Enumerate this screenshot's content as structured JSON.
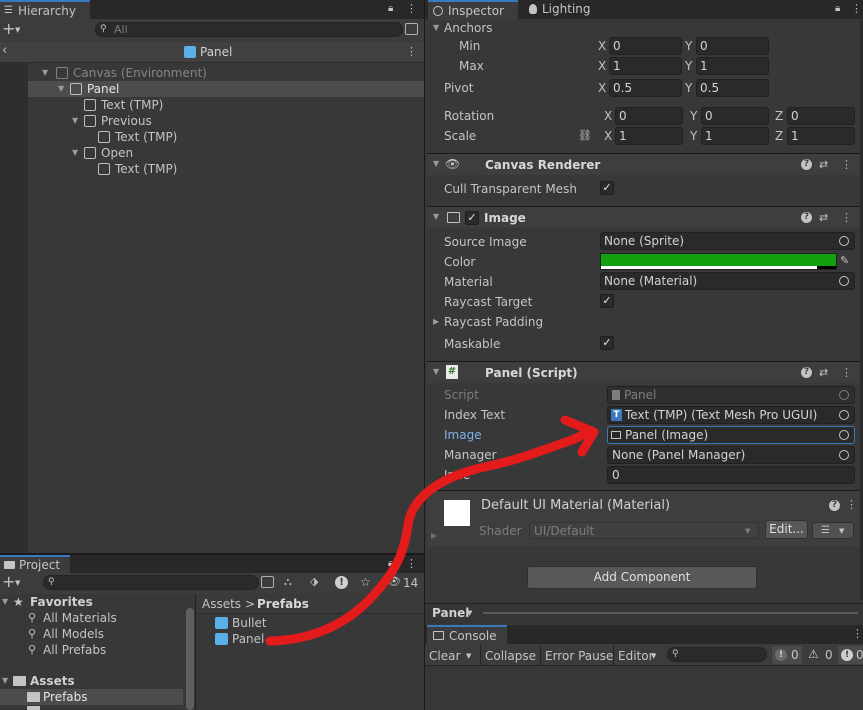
{
  "hierarchy": {
    "tab": "Hierarchy",
    "search_placeholder": "All",
    "scene_title": "Panel",
    "items": [
      {
        "label": "Canvas (Environment)"
      },
      {
        "label": "Panel"
      },
      {
        "label": "Text (TMP)"
      },
      {
        "label": "Previous"
      },
      {
        "label": "Text (TMP)"
      },
      {
        "label": "Open"
      },
      {
        "label": "Text (TMP)"
      }
    ]
  },
  "project": {
    "tab": "Project",
    "hidden_count": "14",
    "favorites": {
      "label": "Favorites",
      "items": [
        "All Materials",
        "All Models",
        "All Prefabs"
      ]
    },
    "assets": {
      "label": "Assets",
      "prefabs": "Prefabs"
    },
    "breadcrumb": {
      "root": "Assets",
      "sep": ">",
      "current": "Prefabs"
    },
    "files": [
      "Bullet",
      "Panel"
    ]
  },
  "inspector": {
    "tabs": [
      "Inspector",
      "Lighting"
    ],
    "rect": {
      "anchors": "Anchors",
      "min_label": "Min",
      "min_x": "0",
      "min_y": "0",
      "max_label": "Max",
      "max_x": "1",
      "max_y": "1",
      "pivot_label": "Pivot",
      "pivot_x": "0.5",
      "pivot_y": "0.5",
      "rotation_label": "Rotation",
      "rot_x": "0",
      "rot_y": "0",
      "rot_z": "0",
      "scale_label": "Scale",
      "scale_x": "1",
      "scale_y": "1",
      "scale_z": "1",
      "axis_x": "X",
      "axis_y": "Y",
      "axis_z": "Z"
    },
    "canvas_renderer": {
      "title": "Canvas Renderer",
      "cull_label": "Cull Transparent Mesh"
    },
    "image": {
      "title": "Image",
      "source_label": "Source Image",
      "source_value": "None (Sprite)",
      "color_label": "Color",
      "color_value": "#14a10f",
      "material_label": "Material",
      "material_value": "None (Material)",
      "raycast_label": "Raycast Target",
      "padding_label": "Raycast Padding",
      "maskable_label": "Maskable"
    },
    "panel_script": {
      "title": "Panel (Script)",
      "script_label": "Script",
      "script_value": "Panel",
      "index_text_label": "Index Text",
      "index_text_value": "Text (TMP) (Text Mesh Pro UGUI)",
      "image_label": "Image",
      "image_value": "Panel (Image)",
      "manager_label": "Manager",
      "manager_value": "None (Panel Manager)",
      "index_label": "Inde",
      "index_value": "0"
    },
    "material": {
      "title": "Default UI Material (Material)",
      "shader_label": "Shader",
      "shader_value": "UI/Default",
      "edit_label": "Edit..."
    },
    "add_component": "Add Component",
    "preview_label": "Panel"
  },
  "console": {
    "tab": "Console",
    "clear": "Clear",
    "collapse": "Collapse",
    "error_pause": "Error Pause",
    "editor": "Editor",
    "err_count": "0",
    "warn_count": "0",
    "log_count": "0"
  },
  "colors": {
    "accent": "#3a79bb",
    "annotation": "#e31b1b",
    "image_color": "#14a10f"
  }
}
